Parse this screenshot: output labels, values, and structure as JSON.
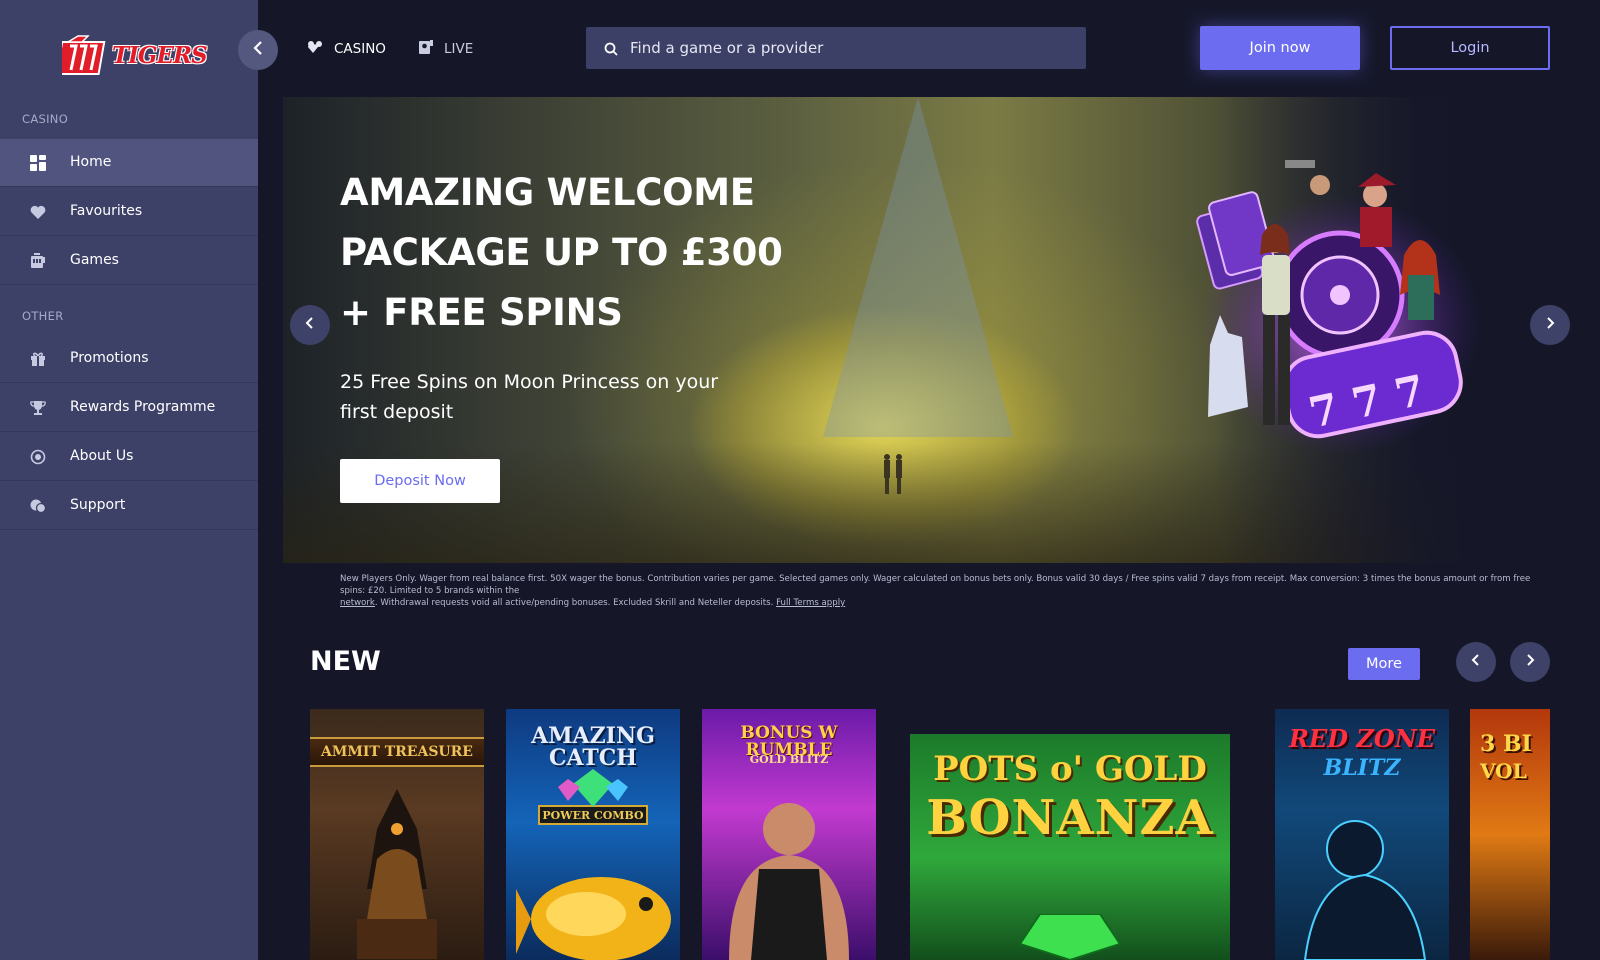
{
  "brand": {
    "name": "TIGERS",
    "accent": "#6b6cf0",
    "sidebar_bg": "#3d4067",
    "page_bg": "#151729"
  },
  "sidebar": {
    "casino_label": "CASINO",
    "other_label": "OTHER",
    "casino_items": [
      {
        "label": "Home",
        "icon": "grid-icon",
        "active": true
      },
      {
        "label": "Favourites",
        "icon": "heart-icon"
      },
      {
        "label": "Games",
        "icon": "slot-machine-icon"
      }
    ],
    "other_items": [
      {
        "label": "Promotions",
        "icon": "gift-icon"
      },
      {
        "label": "Rewards Programme",
        "icon": "trophy-icon"
      },
      {
        "label": "About Us",
        "icon": "info-circle-icon"
      },
      {
        "label": "Support",
        "icon": "chat-bubbles-icon"
      }
    ]
  },
  "header": {
    "tabs": [
      {
        "label": "CASINO",
        "icon": "cards-icon"
      },
      {
        "label": "LIVE",
        "icon": "live-dealer-icon"
      }
    ],
    "search_placeholder": "Find a game or a provider",
    "join_label": "Join now",
    "login_label": "Login"
  },
  "hero": {
    "title_lines": [
      "AMAZING WELCOME",
      "PACKAGE UP TO £300",
      "+ FREE SPINS"
    ],
    "subtitle": "25 Free Spins on Moon Princess on your first deposit",
    "cta_label": "Deposit Now",
    "terms_text": "New Players Only. Wager from real balance first. 50X wager the bonus. Contribution varies per game. Selected games only. Wager calculated on bonus bets only. Bonus valid 30 days / Free spins valid 7 days from receipt. Max conversion: 3 times the bonus amount or from free spins: £20. Limited to 5 brands within the",
    "terms_link_network": "network",
    "terms_text_2": ". Withdrawal requests void all active/pending bonuses. Excluded Skrill and Neteller deposits.",
    "terms_link_full": "Full Terms apply"
  },
  "new_section": {
    "title": "NEW",
    "more_label": "More",
    "games": [
      {
        "title": "AMMIT TREASURE",
        "subtitle": ""
      },
      {
        "title": "AMAZING CATCH",
        "subtitle": "POWER COMBO"
      },
      {
        "title": "BONUS W RUMBLE",
        "subtitle": "GOLD BLITZ"
      },
      {
        "title": "POTS o' GOLD",
        "subtitle": "BONANZA"
      },
      {
        "title": "RED ZONE",
        "subtitle": "BLITZ"
      },
      {
        "title": "3 BI",
        "subtitle": "VOL"
      }
    ]
  }
}
